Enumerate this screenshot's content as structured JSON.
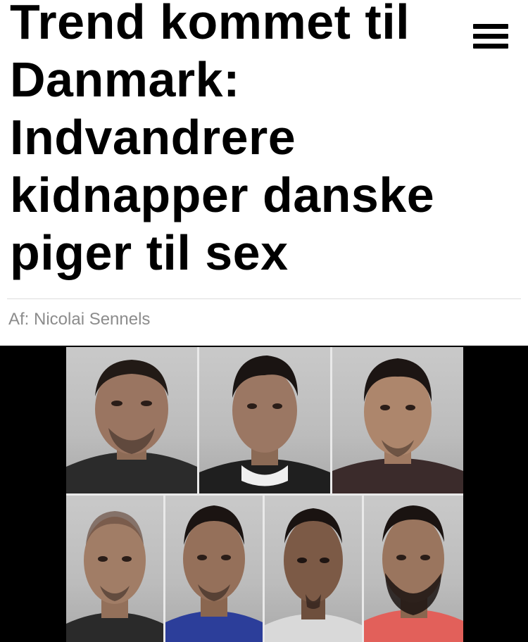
{
  "article": {
    "headline_lines": [
      "Trend kommet til",
      "Danmark:",
      "Indvandrere",
      "kidnapper danske",
      "piger til sex"
    ],
    "byline": "Af: Nicolai Sennels"
  },
  "header": {
    "menu_icon": "hamburger-menu-icon"
  },
  "photo": {
    "description_icon": "mugshot-grid-image",
    "background_color": "#000000",
    "top_row_count": 3,
    "bottom_row_count": 4
  }
}
